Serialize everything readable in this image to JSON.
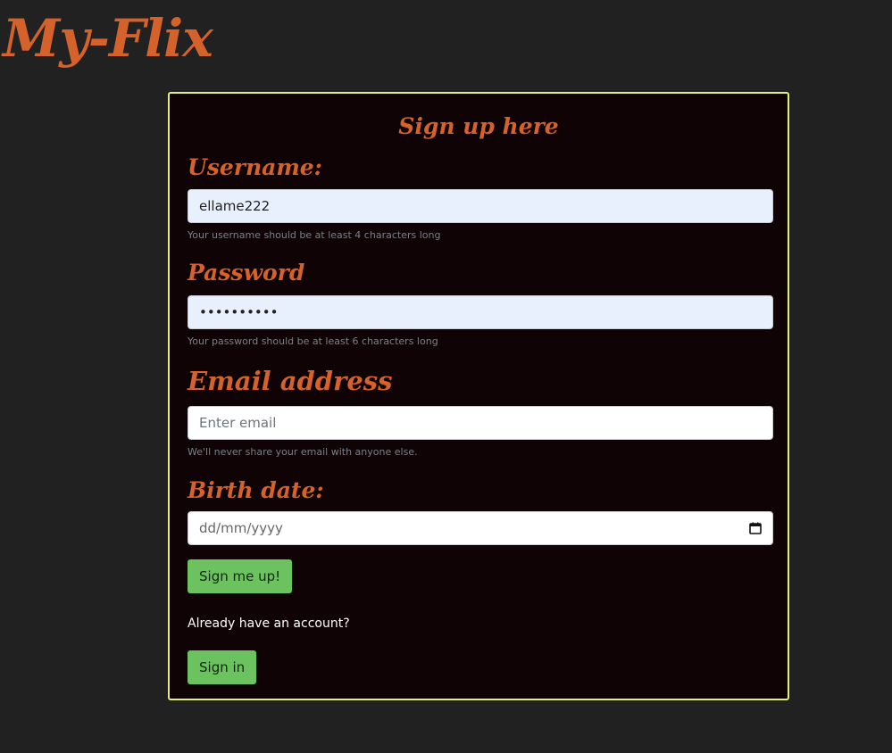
{
  "app": {
    "brand": "My-Flix"
  },
  "form": {
    "heading": "Sign up here",
    "username": {
      "label": "Username:",
      "value": "ellame222",
      "help": "Your username should be at least 4 characters long"
    },
    "password": {
      "label": "Password",
      "value": "••••••••••",
      "help": "Your password should be at least 6 characters long"
    },
    "email": {
      "label": "Email address",
      "placeholder": "Enter email",
      "help": "We'll never share your email with anyone else."
    },
    "birthdate": {
      "label": "Birth date:",
      "placeholder": "dd/mm/yyyy",
      "icon": "calendar-icon"
    },
    "submit_label": "Sign me up!",
    "already_text": "Already have an account?",
    "signin_label": "Sign in"
  },
  "colors": {
    "background": "#212121",
    "card": "#0f0306",
    "card_border": "#e0f080",
    "accent": "#d4622a",
    "button": "#6cc25e"
  }
}
